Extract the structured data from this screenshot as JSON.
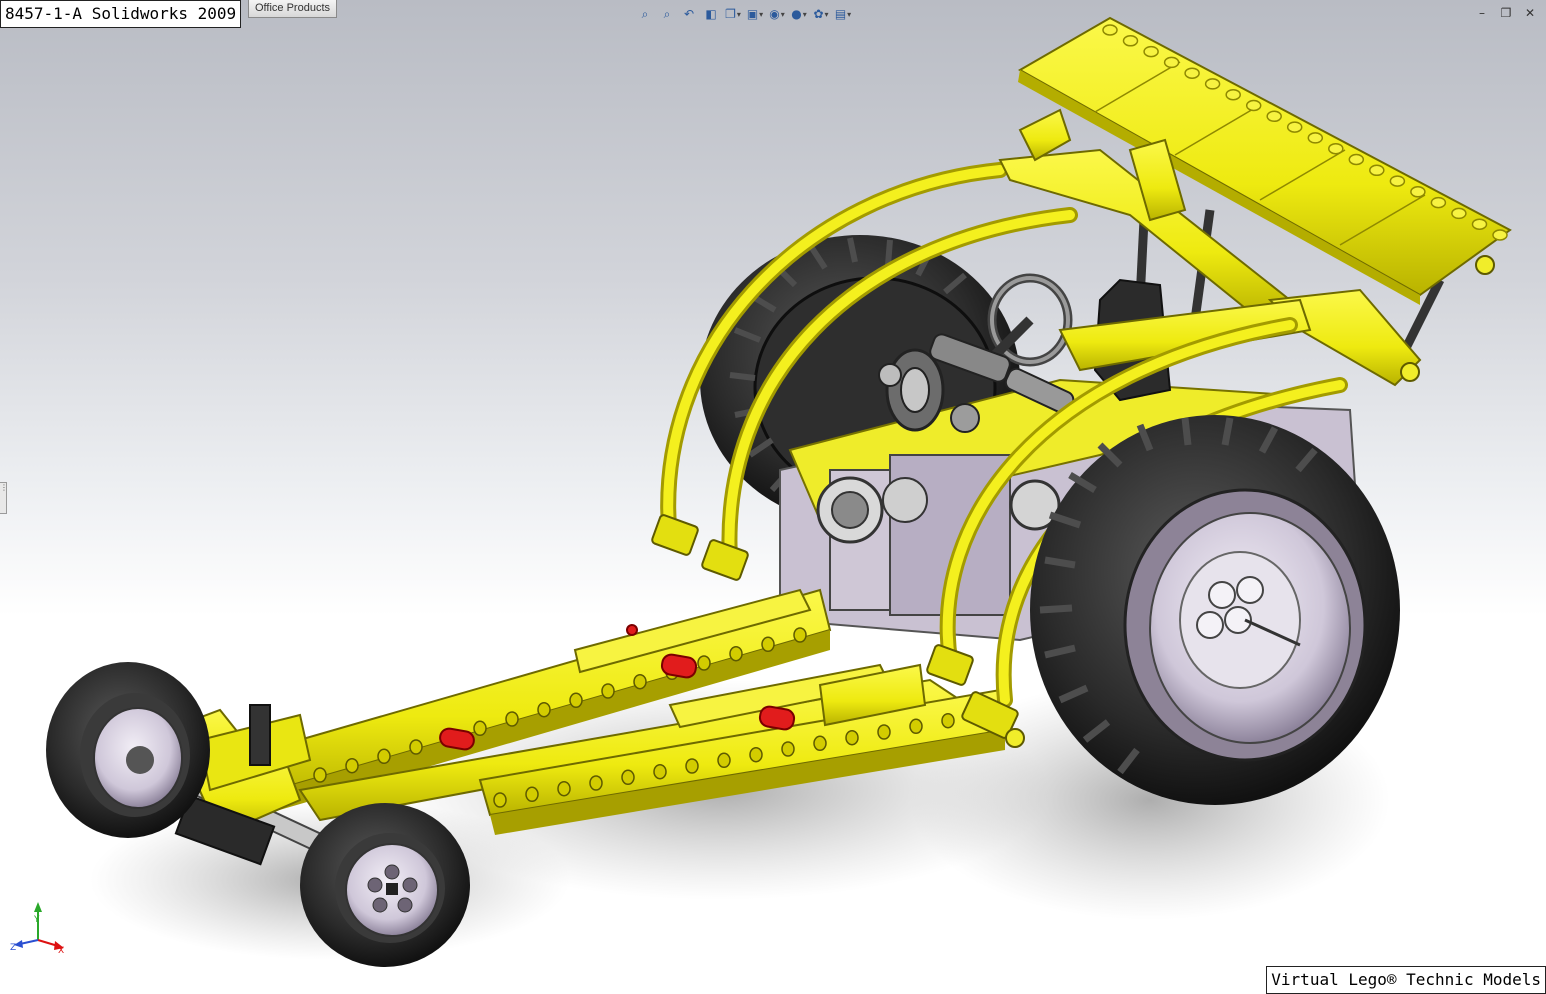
{
  "window": {
    "title_label": "8457-1-A Solidworks 2009",
    "office_tab": "Office Products",
    "footer_label": "Virtual Lego® Technic Models"
  },
  "heads_up_toolbar": [
    {
      "icon": "zoom-to-fit-icon",
      "glyph": "⌕"
    },
    {
      "icon": "zoom-to-area-icon",
      "glyph": "⌕"
    },
    {
      "icon": "previous-view-icon",
      "glyph": "↶"
    },
    {
      "icon": "section-view-icon",
      "glyph": "◧"
    },
    {
      "icon": "view-orientation-icon",
      "glyph": "❐"
    },
    {
      "icon": "display-style-icon",
      "glyph": "▣"
    },
    {
      "icon": "hide-show-items-icon",
      "glyph": "◉"
    },
    {
      "icon": "edit-appearance-icon",
      "glyph": "●"
    },
    {
      "icon": "apply-scene-icon",
      "glyph": "✿"
    },
    {
      "icon": "view-settings-icon",
      "glyph": "▤"
    }
  ],
  "window_controls": [
    {
      "icon": "minimize-icon",
      "glyph": "–"
    },
    {
      "icon": "restore-icon",
      "glyph": "❐"
    },
    {
      "icon": "close-icon",
      "glyph": "✕"
    }
  ],
  "triad": {
    "x_label": "X",
    "y_label": "Y",
    "z_label": "Z"
  },
  "colors": {
    "frame_yellow": "#f2ee16",
    "frame_yellow_dark": "#9a9400",
    "tire_black": "#1c1c1c",
    "rim_lavender": "#b7aec4",
    "pin_red": "#e11c1c",
    "gray_part": "#b9b9b9"
  }
}
